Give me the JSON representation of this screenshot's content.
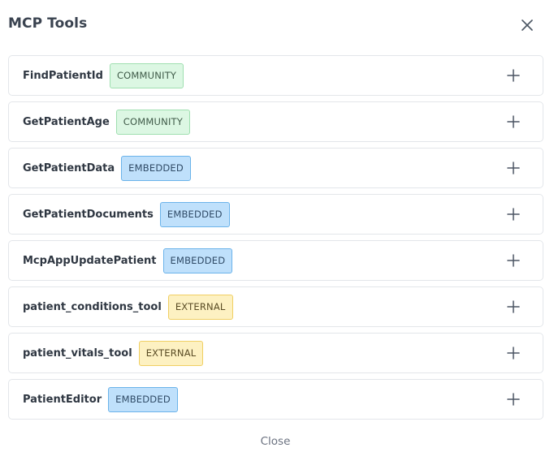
{
  "dialog": {
    "title": "MCP Tools",
    "close_label": "Close"
  },
  "colors": {
    "community_bg": "#dcf7e3",
    "embedded_bg": "#bfe0fb",
    "external_bg": "#fdf1c2"
  },
  "tools": [
    {
      "name": "FindPatientId",
      "badge": "COMMUNITY",
      "kind": "community"
    },
    {
      "name": "GetPatientAge",
      "badge": "COMMUNITY",
      "kind": "community"
    },
    {
      "name": "GetPatientData",
      "badge": "EMBEDDED",
      "kind": "embedded"
    },
    {
      "name": "GetPatientDocuments",
      "badge": "EMBEDDED",
      "kind": "embedded"
    },
    {
      "name": "McpAppUpdatePatient",
      "badge": "EMBEDDED",
      "kind": "embedded"
    },
    {
      "name": "patient_conditions_tool",
      "badge": "EXTERNAL",
      "kind": "external"
    },
    {
      "name": "patient_vitals_tool",
      "badge": "EXTERNAL",
      "kind": "external"
    },
    {
      "name": "PatientEditor",
      "badge": "EMBEDDED",
      "kind": "embedded"
    }
  ],
  "icons": {
    "close": "close-icon",
    "add": "plus-icon"
  }
}
